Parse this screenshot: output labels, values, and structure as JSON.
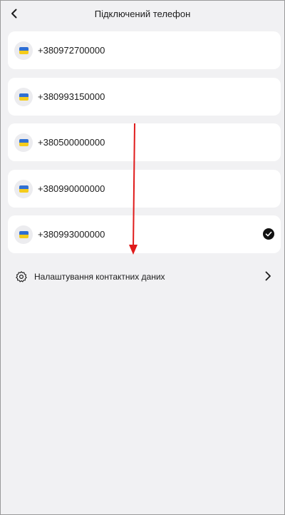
{
  "header": {
    "title": "Підключений телефон",
    "back_icon": "chevron-left-icon"
  },
  "phones": [
    {
      "number": "+380972700000",
      "flag": "ukraine-flag-icon",
      "selected": false
    },
    {
      "number": "+380993150000",
      "flag": "ukraine-flag-icon",
      "selected": false
    },
    {
      "number": "+380500000000",
      "flag": "ukraine-flag-icon",
      "selected": false
    },
    {
      "number": "+380990000000",
      "flag": "ukraine-flag-icon",
      "selected": false
    },
    {
      "number": "+380993000000",
      "flag": "ukraine-flag-icon",
      "selected": true
    }
  ],
  "settings": {
    "label": "Налаштування контактних даних",
    "icon": "gear-icon",
    "chevron": "chevron-right-icon"
  },
  "colors": {
    "background": "#f1f1f3",
    "card": "#ffffff",
    "annotation_arrow": "#e01b1b"
  }
}
